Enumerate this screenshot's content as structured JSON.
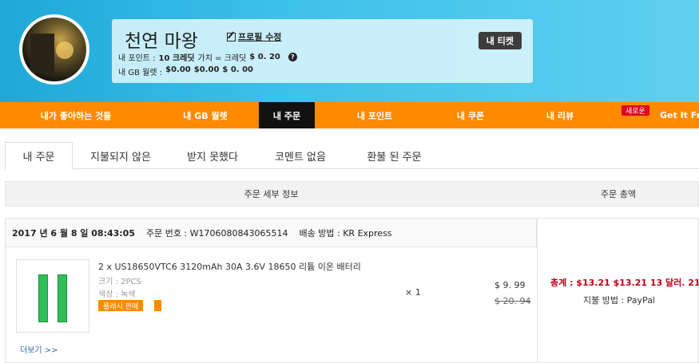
{
  "profile": {
    "name": "천연 마왕",
    "edit_label": "프로필 수정",
    "points_prefix": "내 포인트 :",
    "points_value": "10 크레딧",
    "points_mid": "가치 = 크레딧",
    "points_worth": "$ 0. 20",
    "wallet_prefix": "내 GB 월렛 :",
    "wallet_values": [
      "$0.00",
      "$0.00",
      "$ 0. 00"
    ],
    "ticket_label": "내 티켓"
  },
  "nav": {
    "items": [
      "내가 좋아하는 것들",
      "내 GB 월렛",
      "내 주문",
      "내 포인트",
      "내 쿠폰",
      "내 리뷰",
      "Get It Fr"
    ],
    "active_index": 2,
    "new_badge": "새로운"
  },
  "tabs": {
    "items": [
      "내 주문",
      "지불되지 않은",
      "받지 못했다",
      "코멘트 없음",
      "환불 된 주문"
    ],
    "active_index": 0
  },
  "table": {
    "col_detail": "주문 세부 정보",
    "col_total": "주문 총액"
  },
  "order": {
    "date": "2017 년 6 월 8 일 08:43:05",
    "order_no_label": "주문 번호 :",
    "order_no": "W1706080843065514",
    "shipping_label": "배송 방법 :",
    "shipping": "KR Express",
    "product_title": "2 x US18650VTC6 3120mAh 30A 3.6V 18650 리튬 이온 배터리",
    "size": "크기 : 2PCS",
    "color": "색상 : 녹색",
    "flash_tag": "플래시 판매",
    "qty": "× 1",
    "price": "$ 9. 99",
    "orig_price": "$ 20. 94",
    "more_link": "더보기 >>",
    "total": "총계 : $13.21  $13.21  13 달러. 21",
    "payment": "지불 방법 : PayPal"
  },
  "colors": {
    "nav_orange": "#ff8a00",
    "total_red": "#c0001a",
    "header_blue": "#3cc1ea"
  }
}
